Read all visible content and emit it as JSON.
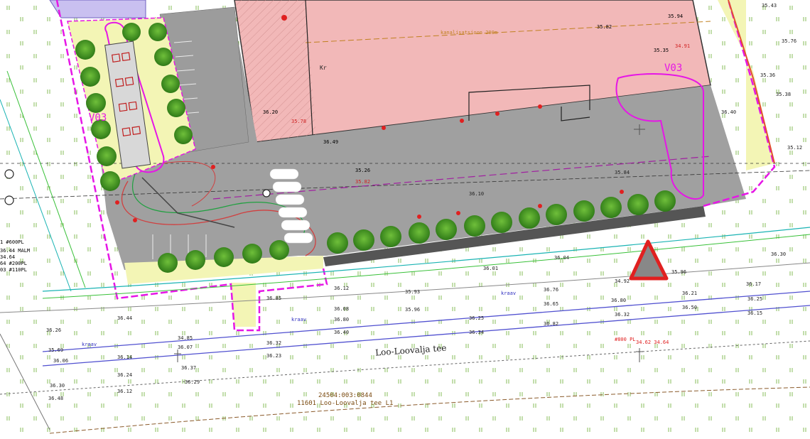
{
  "map": {
    "road_name": "Loo-Loovalja tee",
    "parcel_code": "24504:003:0844",
    "parcel_name": "11601 Loo-Loovalja tee L1",
    "zone_labels": [
      "V03",
      "V03"
    ],
    "building_label": "Kr",
    "pipe_notes": [
      "1 #600PL",
      "36.44 MALM",
      "34.64",
      "64 #200PL",
      "03 #110PL"
    ],
    "elevations": {
      "building": [
        "36.20",
        "35.78",
        "35.82",
        "35.26",
        "36.49",
        "35.94",
        "35.82",
        "34.91",
        "35.35"
      ],
      "road_top": [
        "36.12",
        "36.85",
        "36.08",
        "35.93",
        "35.96",
        "36.76",
        "36.65",
        "34.92",
        "36.32",
        "36.01",
        "36.04",
        "36.10",
        "35.84"
      ],
      "road_bottom": [
        "36.44",
        "34.85",
        "36.07",
        "36.14",
        "36.80",
        "36.40",
        "36.25",
        "36.34",
        "36.82",
        "36.80",
        "36.32"
      ],
      "lower": [
        "36.26",
        "35.69",
        "36.06",
        "36.24",
        "36.37",
        "36.30",
        "36.12",
        "36.48",
        "36.29",
        "36.23"
      ],
      "right_edge": [
        "35.43",
        "35.76",
        "35.36",
        "35.38",
        "35.12",
        "36.40",
        "36.30",
        "36.17",
        "36.25",
        "36.15",
        "35.96",
        "36.50",
        "36.21"
      ]
    },
    "pipe_label_right": "#800 PL",
    "pipe_value_right": "34.62 34.64",
    "distance_note": "kanalisatsioon 200m",
    "kraav_labels": [
      "kraav",
      "kraav",
      "kraav"
    ]
  },
  "icons": [
    "road-sign-triangle",
    "north-marker",
    "tree-icon"
  ],
  "colors": {
    "building": "#f2b8b8",
    "parking": "#9a9a9a",
    "green": "#f3f5b5",
    "boundary": "#e616e6",
    "tree": "#4f9b2a",
    "road_sign": "#e02020"
  }
}
